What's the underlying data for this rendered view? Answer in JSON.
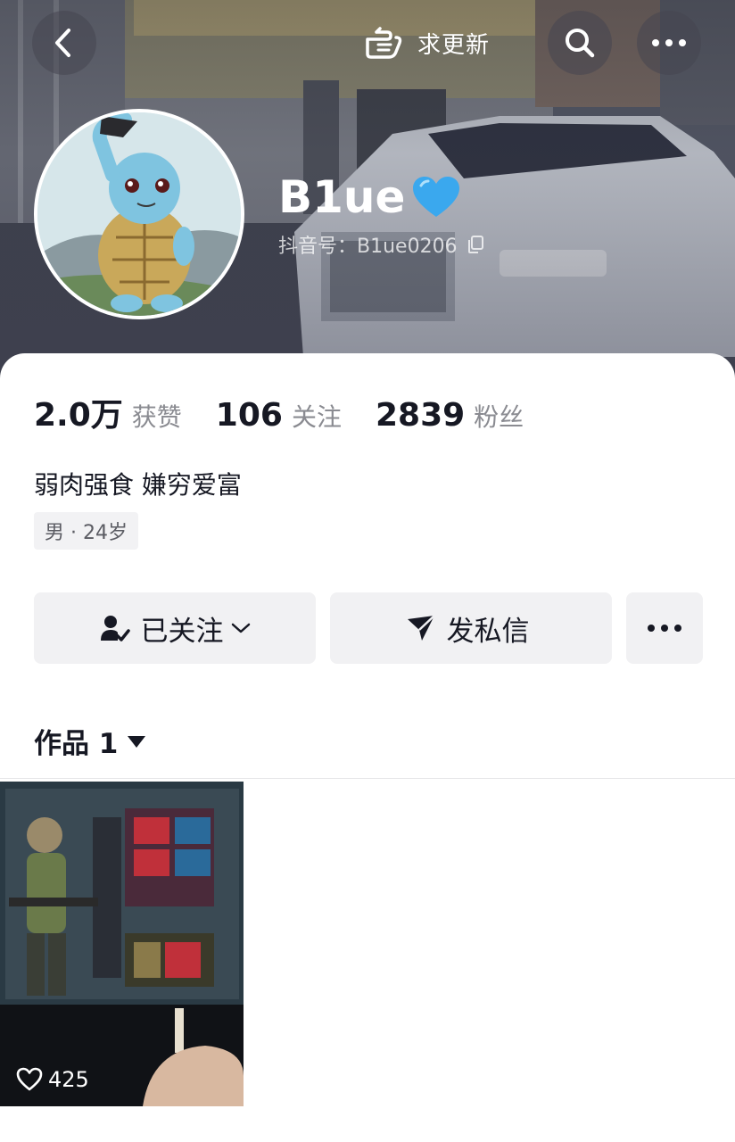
{
  "header": {
    "request_update_label": "求更新",
    "nickname": "B1ue",
    "douyin_id": "抖音号：B1ue0206"
  },
  "stats": [
    {
      "value": "2.0万",
      "label": "获赞"
    },
    {
      "value": "106",
      "label": "关注"
    },
    {
      "value": "2839",
      "label": "粉丝"
    }
  ],
  "bio": "弱肉强食 嫌穷爱富",
  "tag": "男 · 24岁",
  "actions": {
    "followed_label": "已关注",
    "message_label": "发私信"
  },
  "works": {
    "tab_label": "作品 1",
    "items": [
      {
        "likes": "425"
      }
    ]
  },
  "icons": {
    "back": "back-arrow-icon",
    "request_update": "pointing-hand-icon",
    "search": "search-icon",
    "more": "more-dots-icon",
    "verified": "blue-heart-icon",
    "copy": "copy-icon",
    "followed": "user-check-icon",
    "dropdown": "chevron-down-icon",
    "message": "send-icon",
    "works_dropdown": "triangle-down-icon",
    "like": "heart-outline-icon"
  },
  "colors": {
    "heart_blue": "#3aa8ee",
    "text_primary": "#161823",
    "text_secondary": "#8a8b91",
    "button_bg": "#f1f1f3"
  }
}
